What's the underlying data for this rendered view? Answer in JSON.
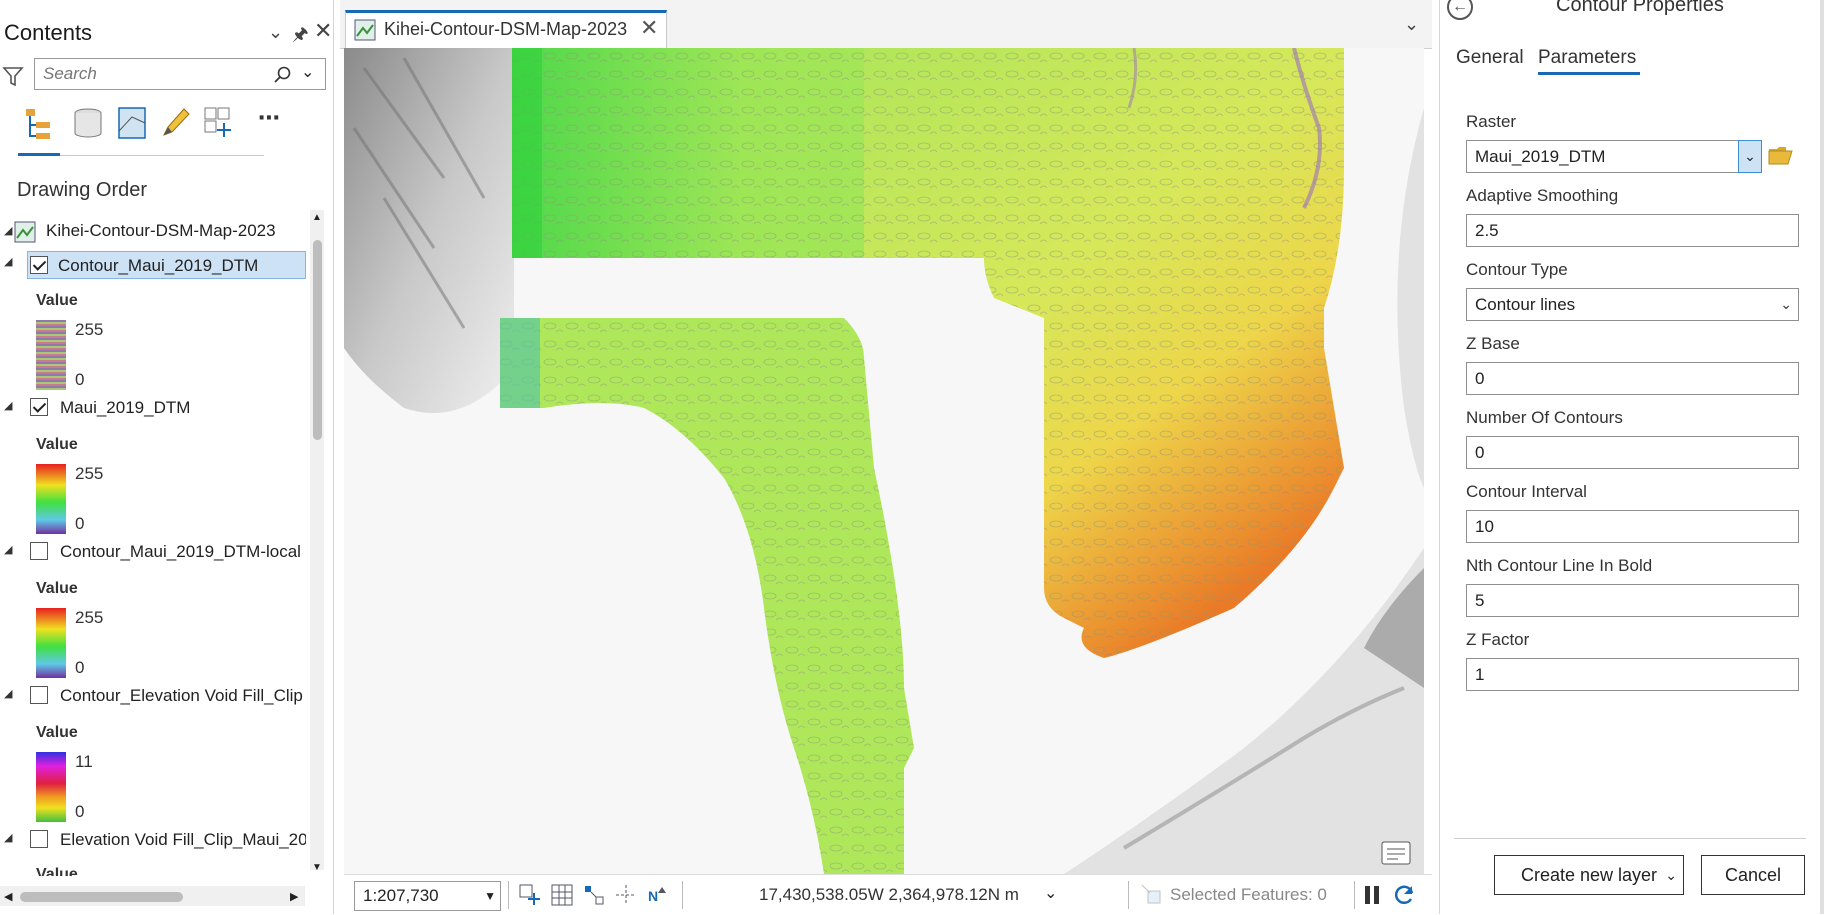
{
  "contents": {
    "title": "Contents",
    "search_placeholder": "Search",
    "section_title": "Drawing Order",
    "map_name": "Kihei-Contour-DSM-Map-2023",
    "layers": [
      {
        "name": "Contour_Maui_2019_DTM",
        "checked": true,
        "selected": true,
        "legend_title": "Value",
        "max": "255",
        "min": "0",
        "ramp": "multistripe"
      },
      {
        "name": "Maui_2019_DTM",
        "checked": true,
        "selected": false,
        "legend_title": "Value",
        "max": "255",
        "min": "0",
        "ramp": "spectral"
      },
      {
        "name": "Contour_Maui_2019_DTM-local",
        "checked": false,
        "selected": false,
        "legend_title": "Value",
        "max": "255",
        "min": "0",
        "ramp": "spectral"
      },
      {
        "name": "Contour_Elevation Void Fill_Clip",
        "checked": false,
        "selected": false,
        "legend_title": "Value",
        "max": "11",
        "min": "0",
        "ramp": "rainbow"
      },
      {
        "name": "Elevation Void Fill_Clip_Maui_20",
        "checked": false,
        "selected": false,
        "legend_title": "Value",
        "max": "",
        "min": "",
        "ramp": "none"
      }
    ]
  },
  "map": {
    "tab_title": "Kihei-Contour-DSM-Map-2023",
    "scale": "1:207,730",
    "coordinates": "17,430,538.05W 2,364,978.12N m",
    "selected_features": "Selected Features: 0"
  },
  "props": {
    "title": "Contour Properties",
    "tabs": [
      "General",
      "Parameters"
    ],
    "active_tab": "Parameters",
    "fields": [
      {
        "label": "Raster",
        "value": "Maui_2019_DTM",
        "kind": "raster"
      },
      {
        "label": "Adaptive Smoothing",
        "value": "2.5",
        "kind": "text"
      },
      {
        "label": "Contour Type",
        "value": "Contour lines",
        "kind": "select"
      },
      {
        "label": "Z Base",
        "value": "0",
        "kind": "text"
      },
      {
        "label": "Number Of Contours",
        "value": "0",
        "kind": "text"
      },
      {
        "label": "Contour Interval",
        "value": "10",
        "kind": "text"
      },
      {
        "label": "Nth Contour Line In Bold",
        "value": "5",
        "kind": "text"
      },
      {
        "label": "Z Factor",
        "value": "1",
        "kind": "text"
      }
    ],
    "create_button": "Create new layer",
    "cancel_button": "Cancel"
  },
  "colors": {
    "accent": "#1769b5",
    "selection": "#cde3f5",
    "map_green": "#a8e85a",
    "map_yellow": "#e6e64a",
    "map_orange": "#e8952e"
  }
}
